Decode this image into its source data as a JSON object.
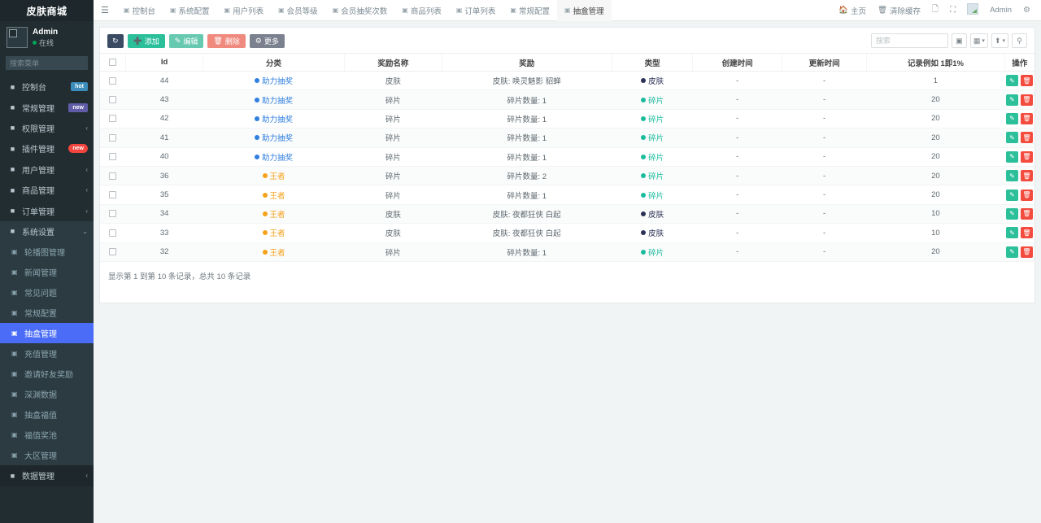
{
  "sidebar": {
    "brand": "皮肤商城",
    "user": {
      "name": "Admin",
      "status": "在线"
    },
    "search_placeholder": "搜索菜单",
    "items": [
      {
        "label": "控制台",
        "icon": "dashboard-icon",
        "badge": "hot",
        "badge_style": "hot",
        "caret": ""
      },
      {
        "label": "常规管理",
        "icon": "share-icon",
        "badge": "new",
        "badge_style": "new-purple",
        "caret": ""
      },
      {
        "label": "权限管理",
        "icon": "users-icon",
        "badge": "",
        "badge_style": "",
        "caret": "‹"
      },
      {
        "label": "插件管理",
        "icon": "rocket-icon",
        "badge": "new",
        "badge_style": "new-red",
        "caret": ""
      },
      {
        "label": "用户管理",
        "icon": "user-circle-icon",
        "badge": "",
        "badge_style": "",
        "caret": "‹"
      },
      {
        "label": "商品管理",
        "icon": "lock-icon",
        "badge": "",
        "badge_style": "",
        "caret": "‹"
      },
      {
        "label": "订单管理",
        "icon": "printer-icon",
        "badge": "",
        "badge_style": "",
        "caret": "‹"
      },
      {
        "label": "系统设置",
        "icon": "gear-icon",
        "badge": "",
        "badge_style": "",
        "caret": "⌄"
      }
    ],
    "submenu": [
      {
        "label": "轮播图管理",
        "active": false
      },
      {
        "label": "新闻管理",
        "active": false
      },
      {
        "label": "常见问题",
        "active": false
      },
      {
        "label": "常规配置",
        "active": false
      },
      {
        "label": "抽盒管理",
        "active": true
      },
      {
        "label": "充值管理",
        "active": false
      },
      {
        "label": "邀请好友奖励",
        "active": false
      },
      {
        "label": "深渊数据",
        "active": false
      },
      {
        "label": "抽盒福值",
        "active": false
      },
      {
        "label": "福值奖池",
        "active": false
      },
      {
        "label": "大区管理",
        "active": false
      }
    ],
    "bottom_item": {
      "label": "数据管理",
      "icon": "database-icon",
      "caret": "‹"
    }
  },
  "topbar": {
    "menu_icon": "hamburger-icon",
    "tabs": [
      {
        "label": "控制台",
        "icon": "dashboard-icon",
        "active": false
      },
      {
        "label": "系统配置",
        "icon": "gear-icon",
        "active": false
      },
      {
        "label": "用户列表",
        "icon": "list-icon",
        "active": false
      },
      {
        "label": "会员等级",
        "icon": "list-icon",
        "active": false
      },
      {
        "label": "会员抽奖次数",
        "icon": "list-icon",
        "active": false
      },
      {
        "label": "商品列表",
        "icon": "list-icon",
        "active": false
      },
      {
        "label": "订单列表",
        "icon": "list-icon",
        "active": false
      },
      {
        "label": "常规配置",
        "icon": "list-icon",
        "active": false
      },
      {
        "label": "抽盒管理",
        "icon": "list-icon",
        "active": true
      }
    ],
    "right": {
      "home_label": "主页",
      "cache_label": "清除缓存",
      "user_label": "Admin"
    }
  },
  "toolbar": {
    "refresh_label": "",
    "add_label": "添加",
    "edit_label": "编辑",
    "delete_label": "删除",
    "more_label": "更多",
    "search_placeholder": "搜索"
  },
  "table": {
    "columns": [
      "",
      "Id",
      "分类",
      "奖励名称",
      "奖励",
      "类型",
      "创建时间",
      "更新时间",
      "记录例如 1即1%",
      "操作"
    ],
    "rows": [
      {
        "id": "44",
        "category": "助力抽奖",
        "cat_color": "#2f7fe0",
        "name": "皮肤",
        "reward": "皮肤: 唤灵魅影 貂蝉",
        "type": "皮肤",
        "type_color": "#2c3156",
        "created": "-",
        "updated": "-",
        "record": "1"
      },
      {
        "id": "43",
        "category": "助力抽奖",
        "cat_color": "#2f7fe0",
        "name": "碎片",
        "reward": "碎片数量: 1",
        "type": "碎片",
        "type_color": "#1abc9c",
        "created": "-",
        "updated": "-",
        "record": "20"
      },
      {
        "id": "42",
        "category": "助力抽奖",
        "cat_color": "#2f7fe0",
        "name": "碎片",
        "reward": "碎片数量: 1",
        "type": "碎片",
        "type_color": "#1abc9c",
        "created": "-",
        "updated": "-",
        "record": "20"
      },
      {
        "id": "41",
        "category": "助力抽奖",
        "cat_color": "#2f7fe0",
        "name": "碎片",
        "reward": "碎片数量: 1",
        "type": "碎片",
        "type_color": "#1abc9c",
        "created": "-",
        "updated": "-",
        "record": "20"
      },
      {
        "id": "40",
        "category": "助力抽奖",
        "cat_color": "#2f7fe0",
        "name": "碎片",
        "reward": "碎片数量: 1",
        "type": "碎片",
        "type_color": "#1abc9c",
        "created": "-",
        "updated": "-",
        "record": "20"
      },
      {
        "id": "36",
        "category": "王者",
        "cat_color": "#f5a11a",
        "name": "碎片",
        "reward": "碎片数量: 2",
        "type": "碎片",
        "type_color": "#1abc9c",
        "created": "-",
        "updated": "-",
        "record": "20"
      },
      {
        "id": "35",
        "category": "王者",
        "cat_color": "#f5a11a",
        "name": "碎片",
        "reward": "碎片数量: 1",
        "type": "碎片",
        "type_color": "#1abc9c",
        "created": "-",
        "updated": "-",
        "record": "20"
      },
      {
        "id": "34",
        "category": "王者",
        "cat_color": "#f5a11a",
        "name": "皮肤",
        "reward": "皮肤: 夜都狂侠 白起",
        "type": "皮肤",
        "type_color": "#2c3156",
        "created": "-",
        "updated": "-",
        "record": "10"
      },
      {
        "id": "33",
        "category": "王者",
        "cat_color": "#f5a11a",
        "name": "皮肤",
        "reward": "皮肤: 夜都狂侠 白起",
        "type": "皮肤",
        "type_color": "#2c3156",
        "created": "-",
        "updated": "-",
        "record": "10"
      },
      {
        "id": "32",
        "category": "王者",
        "cat_color": "#f5a11a",
        "name": "碎片",
        "reward": "碎片数量: 1",
        "type": "碎片",
        "type_color": "#1abc9c",
        "created": "-",
        "updated": "-",
        "record": "20"
      }
    ],
    "footer_info": "显示第 1 到第 10 条记录，总共 10 条记录"
  }
}
